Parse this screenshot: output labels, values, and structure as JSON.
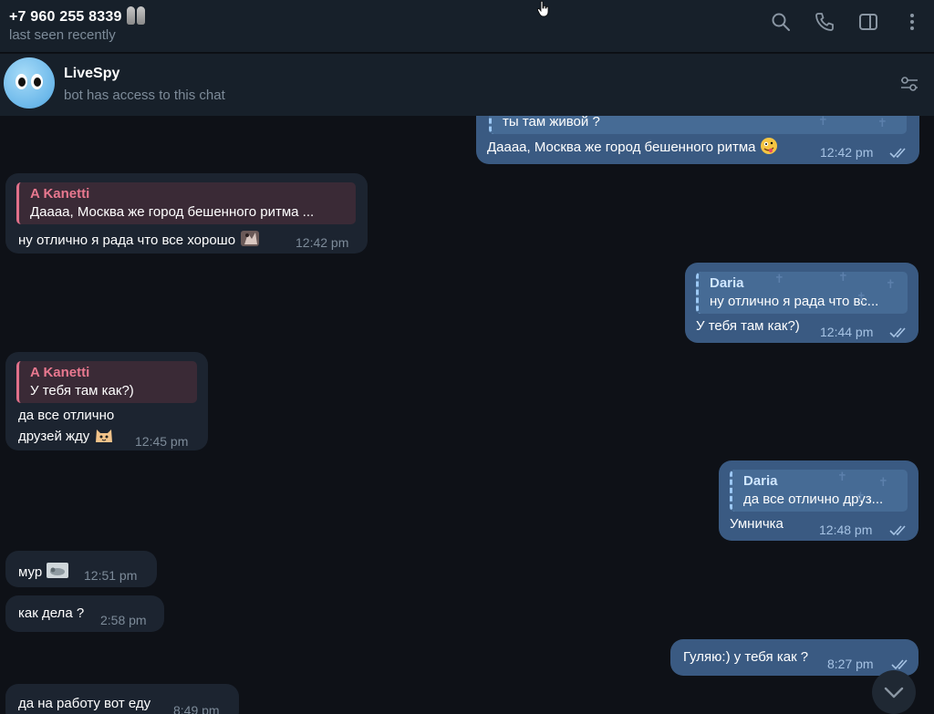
{
  "header": {
    "contact_name": "+7 960 255 8339",
    "contact_emoji": "bone-legs-emoji",
    "status": "last seen recently",
    "icons": [
      "search-icon",
      "phone-icon",
      "sidebar-toggle-icon",
      "more-vertical-icon"
    ]
  },
  "bot_bar": {
    "name": "LiveSpy",
    "subtitle": "bot has access to this chat",
    "avatar": "bot-eyes-avatar",
    "settings_icon": "settings-sliders-icon"
  },
  "messages": [
    {
      "dir": "out",
      "reply_text": "ты там живой ?",
      "text": "Даааа, Москва же город бешенного ритма",
      "emoji": "zany-face-emoji",
      "time": "12:42 pm"
    },
    {
      "dir": "in",
      "reply_name": "A Kanetti",
      "reply_text": "Даааа, Москва же город бешенного ритма ...",
      "text": "ну отлично я рада что все хорошо",
      "emoji": "sticker-emoji",
      "time": "12:42 pm"
    },
    {
      "dir": "out",
      "reply_name": "Daria",
      "reply_text": "ну отлично я рада что вс...",
      "text": "У тебя там как?)",
      "time": "12:44 pm"
    },
    {
      "dir": "in",
      "reply_name": "A Kanetti",
      "reply_text": "У тебя там как?)",
      "text_line1": "да все отлично",
      "text_line2": "друзей жду",
      "emoji": "cat-emoji",
      "time": "12:45 pm"
    },
    {
      "dir": "out",
      "reply_name": "Daria",
      "reply_text": "да все отлично  друз...",
      "text": "Умничка",
      "time": "12:48 pm"
    },
    {
      "dir": "in",
      "text": "мур",
      "emoji": "cat-photo-emoji",
      "time": "12:51 pm"
    },
    {
      "dir": "in",
      "text": "как дела ?",
      "time": "2:58 pm"
    },
    {
      "dir": "out",
      "text": "Гуляю:) у тебя как ?",
      "time": "8:27 pm"
    },
    {
      "dir": "in",
      "text": "да на работу вот еду",
      "time": "8:49 pm"
    }
  ],
  "scroll_down_icon": "chevron-down-icon",
  "colors": {
    "background": "#0e1117",
    "header": "#17202a",
    "incoming_bubble": "#1c2430",
    "outgoing_bubble": "#3a5a82",
    "reply_name_incoming": "#e8788f",
    "time_muted": "#7d8b99"
  }
}
